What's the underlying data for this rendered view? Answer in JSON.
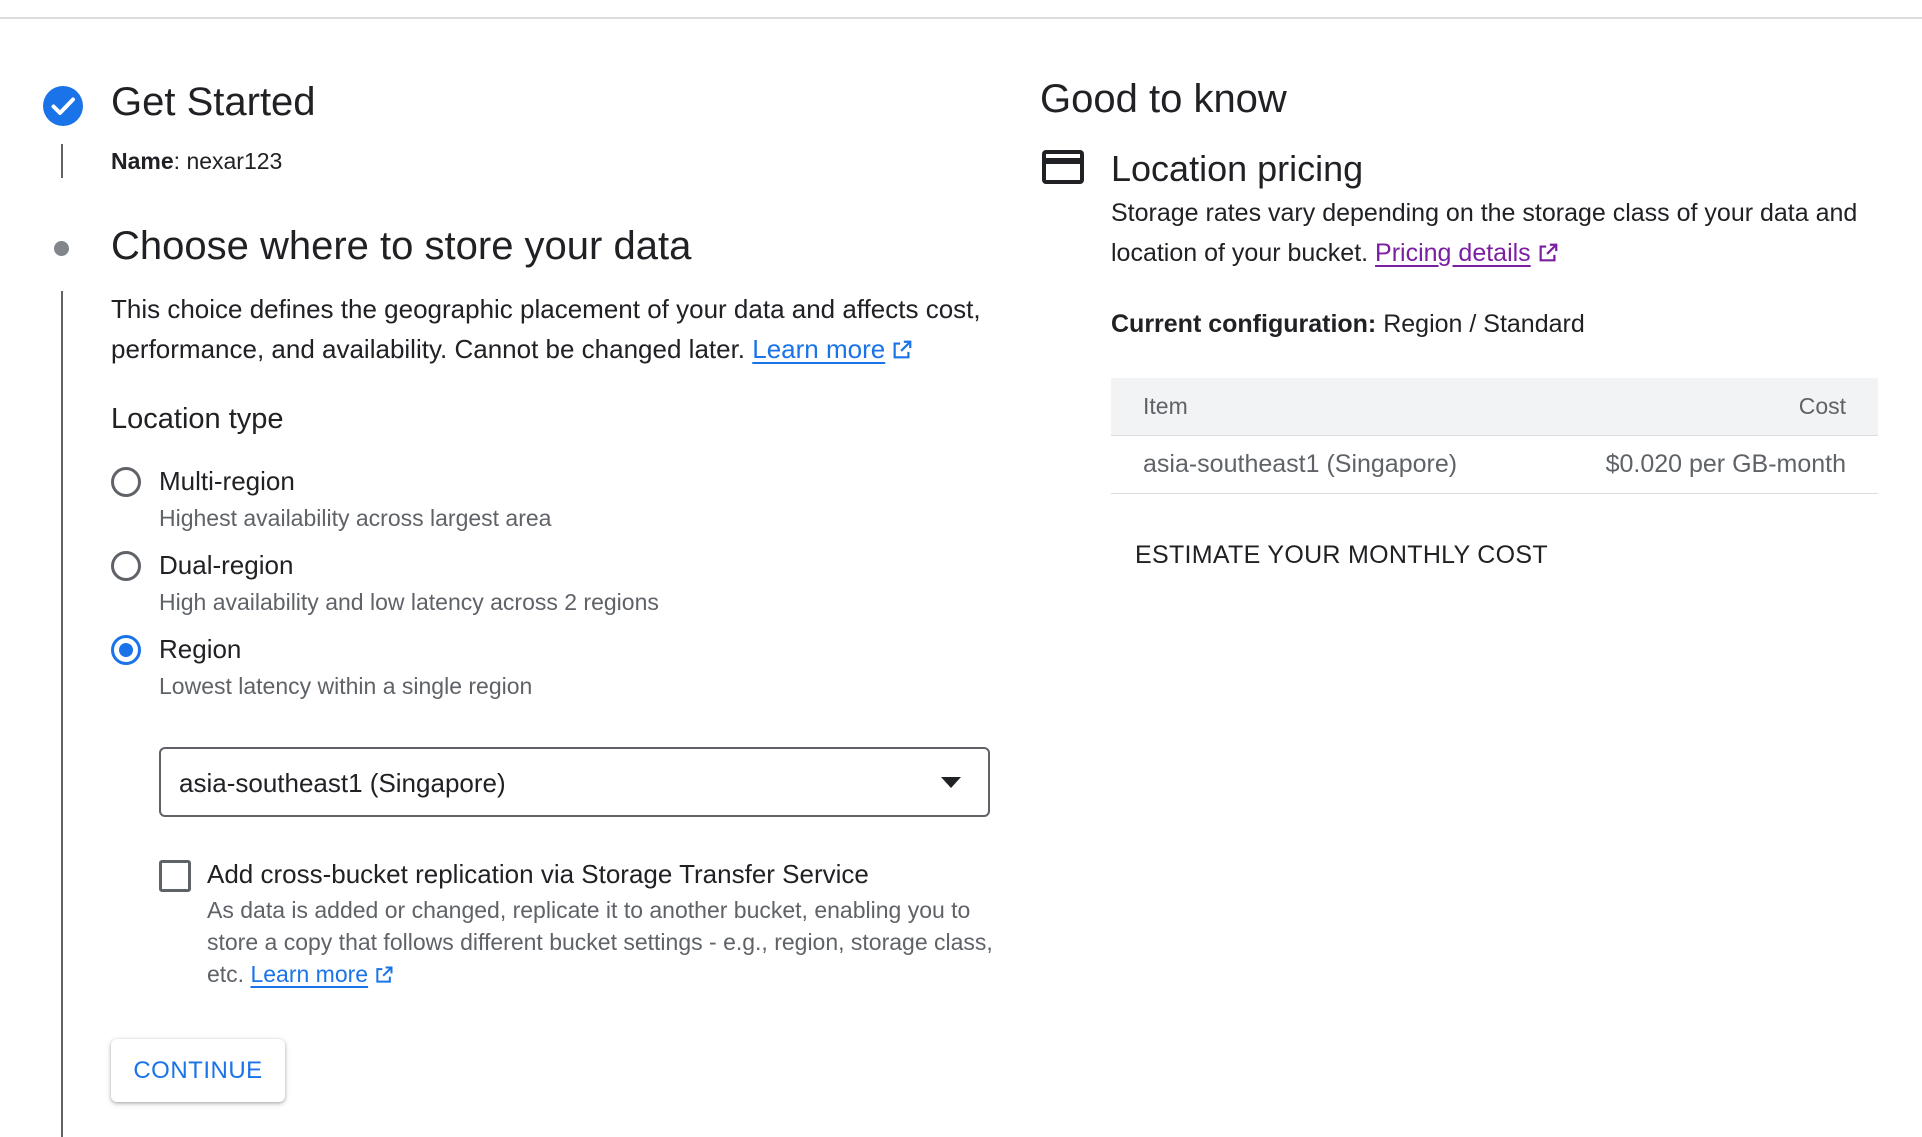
{
  "step1": {
    "title": "Get Started",
    "name_label": "Name",
    "name_value": "nexar123"
  },
  "step2": {
    "title": "Choose where to store your data",
    "description": "This choice defines the geographic placement of your data and affects cost, performance, and availability. Cannot be changed later.",
    "learn_more": "Learn more",
    "location_type_heading": "Location type",
    "options": [
      {
        "label": "Multi-region",
        "description": "Highest availability across largest area",
        "checked": false
      },
      {
        "label": "Dual-region",
        "description": "High availability and low latency across 2 regions",
        "checked": false
      },
      {
        "label": "Region",
        "description": "Lowest latency within a single region",
        "checked": true
      }
    ],
    "region_select_value": "asia-southeast1 (Singapore)",
    "replication": {
      "label": "Add cross-bucket replication via Storage Transfer Service",
      "description": "As data is added or changed, replicate it to another bucket, enabling you to store a copy that follows different bucket settings - e.g., region, storage class, etc.",
      "learn_more": "Learn more",
      "checked": false
    },
    "continue_label": "CONTINUE"
  },
  "info": {
    "title": "Good to know",
    "pricing_title": "Location pricing",
    "pricing_description": "Storage rates vary depending on the storage class of your data and location of your bucket.",
    "pricing_link": "Pricing details",
    "config_label": "Current configuration:",
    "config_value": "Region / Standard",
    "table": {
      "col_item": "Item",
      "col_cost": "Cost",
      "rows": [
        {
          "item": "asia-southeast1 (Singapore)",
          "cost": "$0.020 per GB-month"
        }
      ]
    },
    "estimate_label": "ESTIMATE YOUR MONTHLY COST"
  },
  "colors": {
    "accent": "#1a73e8",
    "visited_link": "#7b1fa2",
    "text": "#202124",
    "secondary_text": "#5f6368"
  },
  "icons": [
    "check-circle-icon",
    "step-dot-icon",
    "external-link-icon",
    "credit-card-icon",
    "dropdown-arrow-icon"
  ]
}
